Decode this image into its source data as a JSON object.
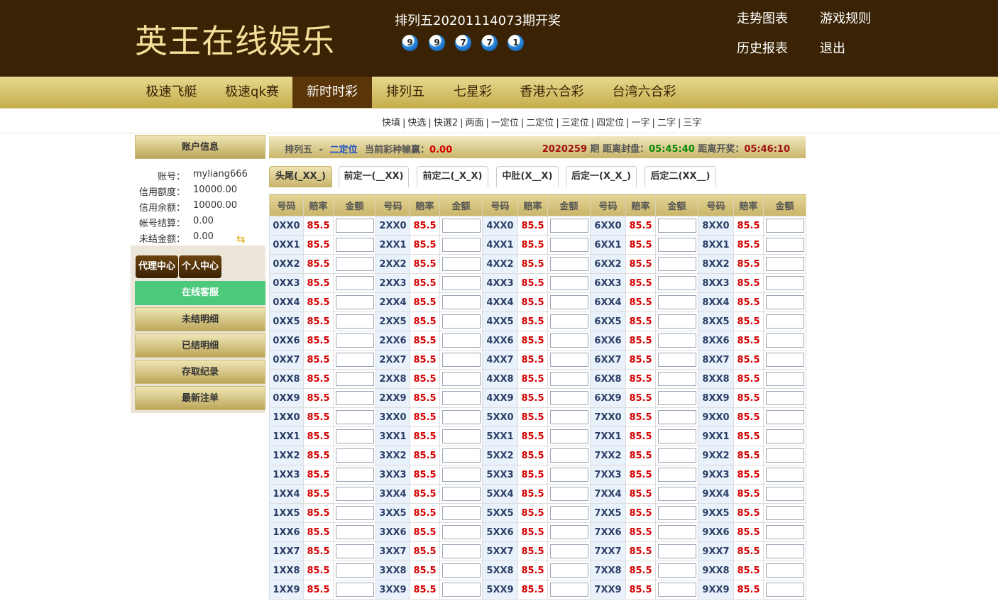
{
  "header": {
    "logo": "英王在线娱乐",
    "draw_title": "排列五20201114073期开奖",
    "balls": [
      "9",
      "9",
      "7",
      "7",
      "1"
    ],
    "links": {
      "trend": "走势图表",
      "rules": "游戏规则",
      "history": "历史报表",
      "logout": "退出"
    }
  },
  "main_nav": {
    "items": [
      "极速飞艇",
      "极速qk赛",
      "新时时彩",
      "排列五",
      "七星彩",
      "香港六合彩",
      "台湾六合彩"
    ],
    "active": "新时时彩"
  },
  "sub_nav": {
    "items": [
      "快填",
      "快选",
      "快選2",
      "两面",
      "一定位",
      "二定位",
      "三定位",
      "四定位",
      "一字",
      "二字",
      "三字"
    ]
  },
  "sidebar": {
    "account_title": "账户信息",
    "account": [
      {
        "label": "账号：",
        "value": "myliang666"
      },
      {
        "label": "信用额度：",
        "value": "10000.00"
      },
      {
        "label": "信用余额：",
        "value": "10000.00"
      },
      {
        "label": "帐号结算：",
        "value": "0.00"
      },
      {
        "label": "未结金额：",
        "value": "0.00"
      }
    ],
    "agent_center": "代理中心",
    "personal_center": "个人中心",
    "online_service": "在线客服",
    "menu": [
      "未结明细",
      "已结明细",
      "存取纪录",
      "最新注单"
    ]
  },
  "info_bar": {
    "game": "排列五",
    "dash": "-",
    "play": "二定位",
    "loss_label": "当前彩种输赢：",
    "loss_value": "0.00",
    "issue": "2020259",
    "issue_unit": "期",
    "close_label": "距离封盘：",
    "close_time": "05:45:40",
    "open_label": "距离开奖：",
    "open_time": "05:46:10"
  },
  "tabs": [
    "头尾(_XX_)",
    "前定一(__XX)",
    "前定二(_X_X)",
    "中肚(X__X)",
    "后定一(X_X_)",
    "后定二(XX__)"
  ],
  "active_tab": 0,
  "table": {
    "headers": [
      "号码",
      "赔率",
      "金额"
    ],
    "odds": "85.5",
    "columns": [
      [
        "0XX0",
        "0XX1",
        "0XX2",
        "0XX3",
        "0XX4",
        "0XX5",
        "0XX6",
        "0XX7",
        "0XX8",
        "0XX9",
        "1XX0",
        "1XX1",
        "1XX2",
        "1XX3",
        "1XX4",
        "1XX5",
        "1XX6",
        "1XX7",
        "1XX8",
        "1XX9"
      ],
      [
        "2XX0",
        "2XX1",
        "2XX2",
        "2XX3",
        "2XX4",
        "2XX5",
        "2XX6",
        "2XX7",
        "2XX8",
        "2XX9",
        "3XX0",
        "3XX1",
        "3XX2",
        "3XX3",
        "3XX4",
        "3XX5",
        "3XX6",
        "3XX7",
        "3XX8",
        "3XX9"
      ],
      [
        "4XX0",
        "4XX1",
        "4XX2",
        "4XX3",
        "4XX4",
        "4XX5",
        "4XX6",
        "4XX7",
        "4XX8",
        "4XX9",
        "5XX0",
        "5XX1",
        "5XX2",
        "5XX3",
        "5XX4",
        "5XX5",
        "5XX6",
        "5XX7",
        "5XX8",
        "5XX9"
      ],
      [
        "6XX0",
        "6XX1",
        "6XX2",
        "6XX3",
        "6XX4",
        "6XX5",
        "6XX6",
        "6XX7",
        "6XX8",
        "6XX9",
        "7XX0",
        "7XX1",
        "7XX2",
        "7XX3",
        "7XX4",
        "7XX5",
        "7XX6",
        "7XX7",
        "7XX8",
        "7XX9"
      ],
      [
        "8XX0",
        "8XX1",
        "8XX2",
        "8XX3",
        "8XX4",
        "8XX5",
        "8XX6",
        "8XX7",
        "8XX8",
        "8XX9",
        "9XX0",
        "9XX1",
        "9XX2",
        "9XX3",
        "9XX4",
        "9XX5",
        "9XX6",
        "9XX7",
        "9XX8",
        "9XX9"
      ]
    ]
  }
}
